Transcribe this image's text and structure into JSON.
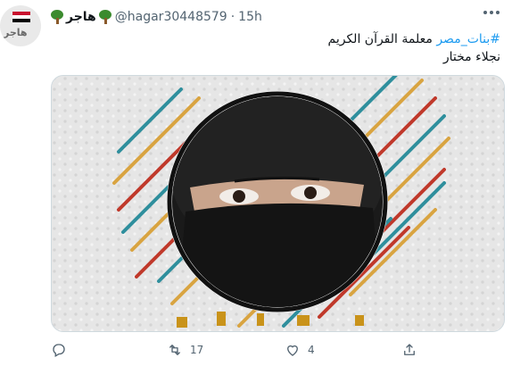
{
  "colors": {
    "accent": "#1d9bf0",
    "secondary_text": "#536471",
    "name_text": "#0f1419"
  },
  "avatar": {
    "text": "هاجر",
    "icon": "avatar-flag"
  },
  "header": {
    "name": "هاجر",
    "name_icons": [
      "tree-icon",
      "tree-icon"
    ],
    "handle": "@hagar30448579",
    "separator": "·",
    "time": "15h"
  },
  "tweet": {
    "hashtag": "#بنات_مصر",
    "text_line1": "معلمة القرآن الكريم",
    "text_line2": "نجلاء مختار"
  },
  "actions": {
    "reply": {
      "icon": "reply-icon",
      "count": ""
    },
    "retweet": {
      "icon": "retweet-icon",
      "count": "17"
    },
    "like": {
      "icon": "heart-icon",
      "count": "4"
    },
    "share": {
      "icon": "share-icon",
      "count": ""
    }
  }
}
